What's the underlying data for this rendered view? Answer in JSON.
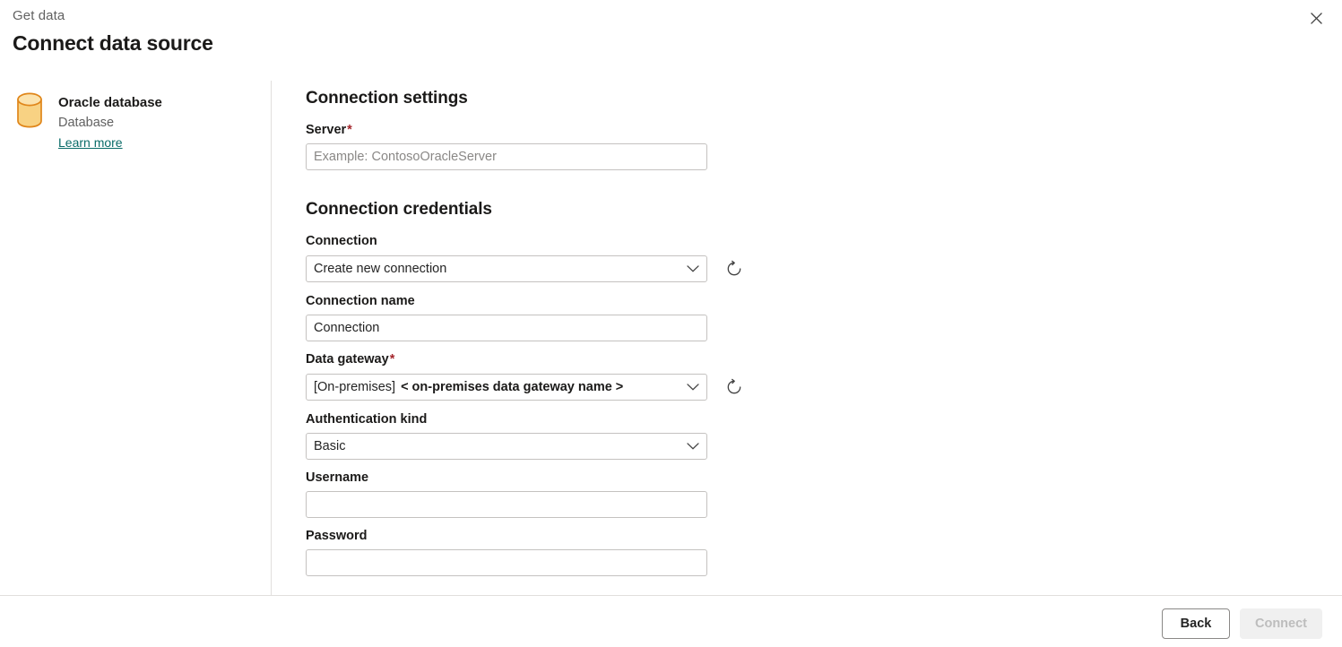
{
  "header": {
    "eyebrow": "Get data",
    "title": "Connect data source",
    "close_icon": "close-icon"
  },
  "source": {
    "icon": "database-cylinder-icon",
    "name": "Oracle database",
    "type": "Database",
    "learn_more": "Learn more",
    "link_color": "#096b68",
    "icon_fill": "#f6cf7a",
    "icon_stroke": "#e08a1e"
  },
  "form": {
    "settings_heading": "Connection settings",
    "credentials_heading": "Connection credentials",
    "required_marker": "*",
    "required_color": "#a4262c",
    "server": {
      "label": "Server",
      "required": true,
      "value": "",
      "placeholder": "Example: ContosoOracleServer"
    },
    "connection": {
      "label": "Connection",
      "required": false,
      "value": "Create new connection",
      "refresh_icon": "refresh-icon",
      "chevron_icon": "chevron-down-icon"
    },
    "connection_name": {
      "label": "Connection name",
      "required": false,
      "value": "Connection",
      "placeholder": ""
    },
    "data_gateway": {
      "label": "Data gateway",
      "required": true,
      "value_prefix": "[On-premises]",
      "value_name": "< on-premises data gateway name >",
      "refresh_icon": "refresh-icon",
      "chevron_icon": "chevron-down-icon"
    },
    "authentication_kind": {
      "label": "Authentication kind",
      "required": false,
      "value": "Basic",
      "chevron_icon": "chevron-down-icon"
    },
    "username": {
      "label": "Username",
      "required": false,
      "value": "",
      "placeholder": ""
    },
    "password": {
      "label": "Password",
      "required": false,
      "value": "",
      "placeholder": ""
    }
  },
  "footer": {
    "back_label": "Back",
    "connect_label": "Connect",
    "connect_disabled": true
  }
}
